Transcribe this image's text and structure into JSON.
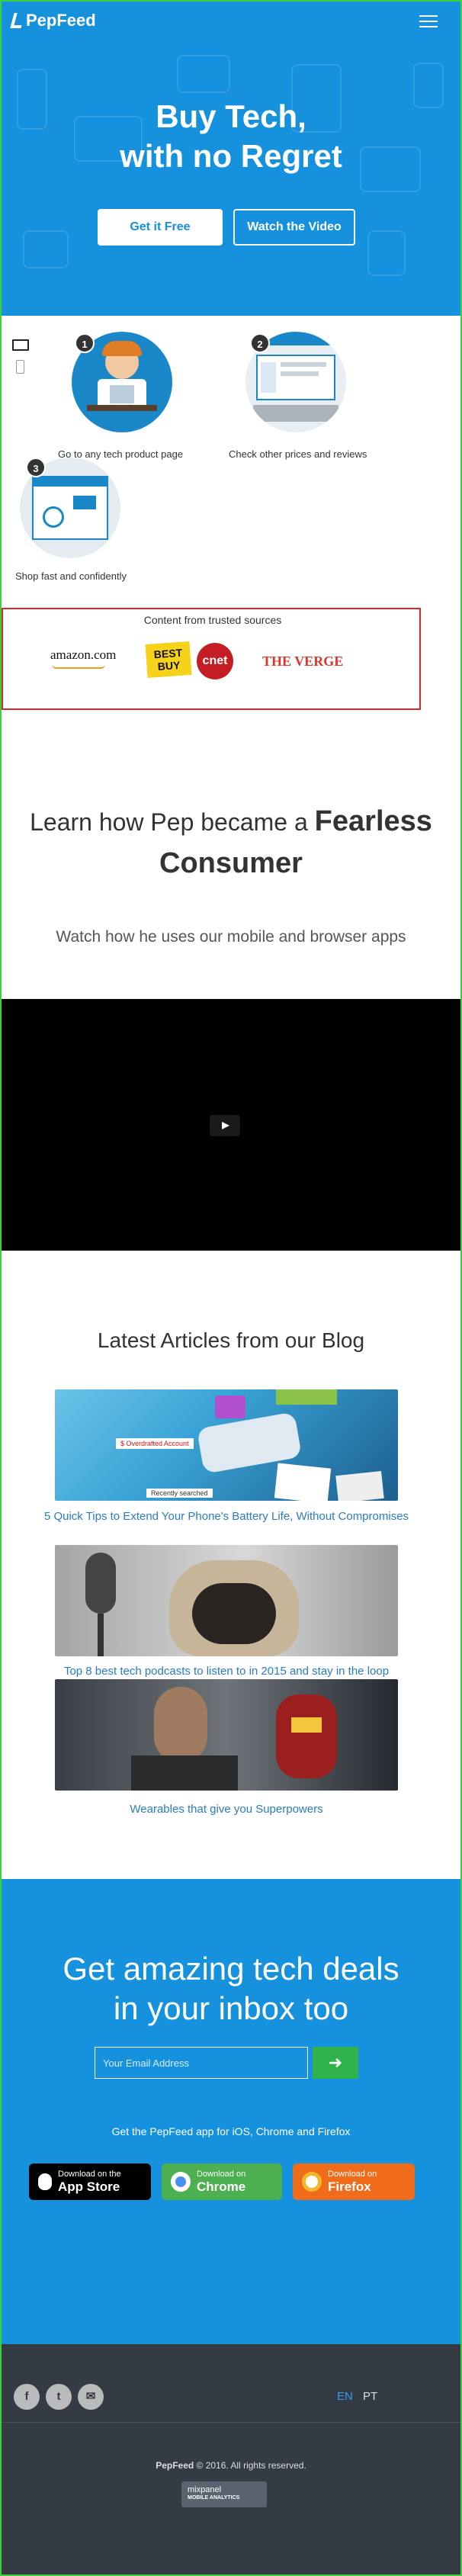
{
  "header": {
    "logo": "PepFeed",
    "title_line1": "Buy Tech,",
    "title_line2": "with no Regret",
    "btn_get": "Get it Free",
    "btn_watch": "Watch the Video"
  },
  "steps": [
    {
      "num": "1",
      "label": "Go to any tech product page"
    },
    {
      "num": "2",
      "label": "Check other prices and reviews"
    },
    {
      "num": "3",
      "label": "Shop fast and confidently"
    }
  ],
  "trusted": {
    "title": "Content from trusted sources",
    "logos": [
      "amazon.com",
      "BEST BUY",
      "cnet",
      "THE VERGE"
    ]
  },
  "learn": {
    "line1": "Learn how Pep became a",
    "bold1": "Fearless",
    "bold2": "Consumer",
    "sub": "Watch how he uses our mobile and browser apps"
  },
  "blog": {
    "title": "Latest Articles from our Blog",
    "posts": [
      {
        "title": "5 Quick Tips to Extend Your Phone's Battery Life, Without Compromises",
        "badge1": "$ Overdrafted Account",
        "badge2": "Recently searched"
      },
      {
        "title": "Top 8 best tech podcasts to listen to in 2015 and stay in the loop"
      },
      {
        "title": "Wearables that give you Superpowers"
      }
    ]
  },
  "newsletter": {
    "title_line1": "Get amazing tech deals",
    "title_line2": "in your inbox too",
    "placeholder": "Your Email Address",
    "submit": "➜",
    "apps_text": "Get the PepFeed app for iOS, Chrome and Firefox",
    "stores": [
      {
        "small": "Download on the",
        "big": "App Store",
        "color": "#000000"
      },
      {
        "small": "Download on",
        "big": "Chrome",
        "color": "#4caf50"
      },
      {
        "small": "Download on",
        "big": "Firefox",
        "color": "#ef6c1a"
      }
    ]
  },
  "footer": {
    "lang_en": "EN",
    "lang_pt": "PT",
    "brand": "PepFeed",
    "copyright": " © 2016. All rights reserved.",
    "badge_line1": "mixpanel",
    "badge_line2": "MOBILE ANALYTICS"
  },
  "colors": {
    "brand_blue": "#1591dd",
    "footer": "#353b45",
    "link": "#2a7bc5"
  }
}
